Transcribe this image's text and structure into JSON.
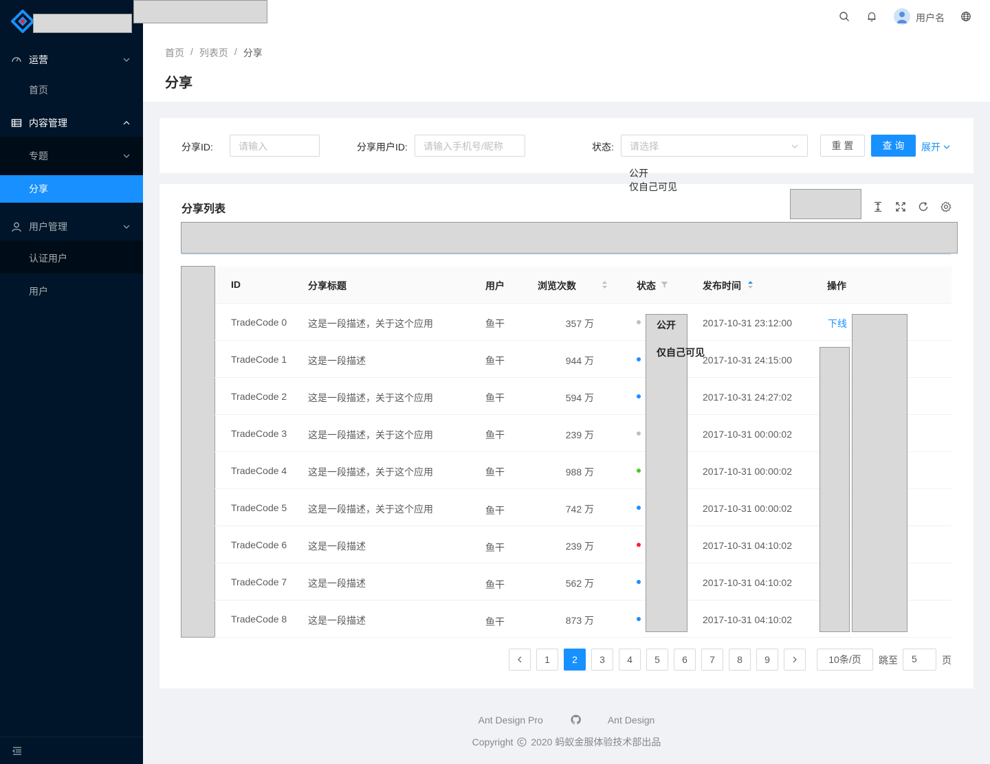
{
  "sidebar": {
    "items": [
      {
        "label": "运营"
      },
      {
        "label": "首页"
      },
      {
        "label": "内容管理"
      },
      {
        "label": "专题"
      },
      {
        "label": "分享"
      },
      {
        "label": "用户管理"
      },
      {
        "label": "认证用户"
      },
      {
        "label": "用户"
      }
    ]
  },
  "header": {
    "username": "用户名"
  },
  "breadcrumb": [
    "首页",
    "/",
    "列表页",
    "/",
    "分享"
  ],
  "page_title": "分享",
  "filter": {
    "share_id_label": "分享ID:",
    "share_id_placeholder": "请输入",
    "user_id_label": "分享用户ID:",
    "user_id_placeholder": "请输入手机号/昵称",
    "status_label": "状态:",
    "status_placeholder": "请选择",
    "reset": "重 置",
    "query": "查 询",
    "expand": "展开",
    "status_options": [
      "公开",
      "仅自己可见"
    ]
  },
  "table": {
    "title": "分享列表",
    "columns": [
      "ID",
      "分享标题",
      "用户",
      "浏览次数",
      "状态",
      "发布时间",
      "操作"
    ],
    "status_popup": [
      "公开",
      "仅自己可见"
    ],
    "action": "下线",
    "status_colors": {
      "grey": "#bfbfbf",
      "blue": "#1890ff",
      "green": "#52c41a",
      "red": "#f5222d"
    },
    "rows": [
      {
        "id": "TradeCode 0",
        "title": "这是一段描述，关于这个应用",
        "user": "鱼干",
        "views": "357 万",
        "status": "grey",
        "time": "2017-10-31  23:12:00"
      },
      {
        "id": "TradeCode 1",
        "title": "这是一段描述",
        "user": "鱼干",
        "views": "944 万",
        "status": "blue",
        "time": "2017-10-31  24:15:00"
      },
      {
        "id": "TradeCode 2",
        "title": "这是一段描述，关于这个应用",
        "user": "鱼干",
        "views": "594 万",
        "status": "blue",
        "time": "2017-10-31  24:27:02"
      },
      {
        "id": "TradeCode 3",
        "title": "这是一段描述，关于这个应用",
        "user": "鱼干",
        "views": "239 万",
        "status": "grey",
        "time": "2017-10-31  00:00:02"
      },
      {
        "id": "TradeCode 4",
        "title": "这是一段描述，关于这个应用",
        "user": "鱼干",
        "views": "988 万",
        "status": "green",
        "time": "2017-10-31  00:00:02"
      },
      {
        "id": "TradeCode 5",
        "title": "这是一段描述，关于这个应用",
        "user": "鱼干",
        "views": "742 万",
        "status": "blue",
        "time": "2017-10-31  00:00:02"
      },
      {
        "id": "TradeCode 6",
        "title": "这是一段描述",
        "user": "鱼干",
        "views": "239 万",
        "status": "red",
        "time": "2017-10-31  04:10:02"
      },
      {
        "id": "TradeCode 7",
        "title": "这是一段描述",
        "user": "鱼干",
        "views": "562 万",
        "status": "blue",
        "time": "2017-10-31  04:10:02"
      },
      {
        "id": "TradeCode 8",
        "title": "这是一段描述",
        "user": "鱼干",
        "views": "873 万",
        "status": "blue",
        "time": "2017-10-31  04:10:02"
      }
    ]
  },
  "pagination": {
    "pages": [
      "1",
      "2",
      "3",
      "4",
      "5",
      "6",
      "7",
      "8",
      "9"
    ],
    "current": "2",
    "page_size": "10条/页",
    "jump_label": "跳至",
    "jump_value": "5",
    "page_suffix": "页"
  },
  "footer": {
    "link1": "Ant Design Pro",
    "link2": "Ant Design",
    "copyright": "Copyright",
    "copyright_text": "2020 蚂蚁金服体验技术部出品"
  }
}
